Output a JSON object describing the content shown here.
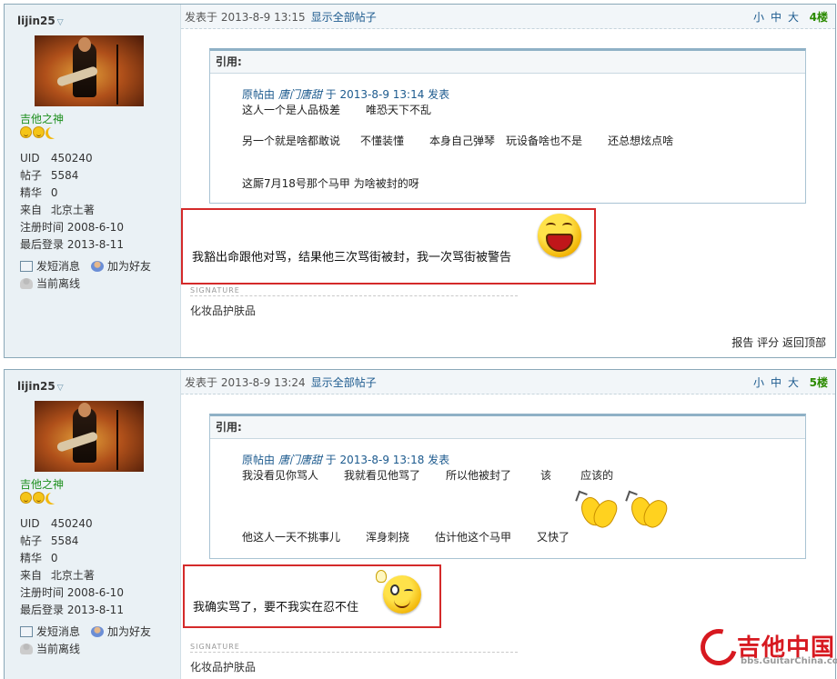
{
  "posts": [
    {
      "user": {
        "name": "lijin25",
        "rank": "吉他之神",
        "stats": [
          {
            "label": "UID",
            "value": "450240"
          },
          {
            "label": "帖子",
            "value": "5584"
          },
          {
            "label": "精华",
            "value": "0"
          },
          {
            "label": "来自",
            "value": "北京土著"
          },
          {
            "label": "注册时间",
            "value": "2008-6-10"
          },
          {
            "label": "最后登录",
            "value": "2013-8-11"
          }
        ],
        "send_msg": "发短消息",
        "add_friend": "加为好友",
        "status": "当前离线"
      },
      "posted_at": "发表于 2013-8-9 13:15",
      "show_all": "显示全部帖子",
      "font_small": "小",
      "font_medium": "中",
      "font_large": "大",
      "floor": "4楼",
      "quote": {
        "label": "引用:",
        "lines": [
          {
            "prefix": "原帖由",
            "author": "唐门唐甜",
            "suffix": "于 2013-8-9 13:14 发表"
          },
          {
            "parts": [
              "这人一个是人品极差",
              "唯恐天下不乱"
            ]
          },
          {
            "parts": [
              "另一个就是啥都敢说",
              "不懂装懂",
              "本身自己弹琴",
              "玩设备啥也不是",
              "还总想炫点啥"
            ]
          },
          {
            "parts": [
              "这厮7月18号那个马甲 为啥被封的呀"
            ]
          }
        ]
      },
      "message": "我豁出命跟他对骂，结果他三次骂街被封，我一次骂街被警告",
      "signature_label": "SIGNATURE",
      "signature": "化妆品护肤品",
      "footer": {
        "report": "报告",
        "rate": "评分",
        "top": "返回顶部"
      }
    },
    {
      "user": {
        "name": "lijin25",
        "rank": "吉他之神",
        "stats": [
          {
            "label": "UID",
            "value": "450240"
          },
          {
            "label": "帖子",
            "value": "5584"
          },
          {
            "label": "精华",
            "value": "0"
          },
          {
            "label": "来自",
            "value": "北京土著"
          },
          {
            "label": "注册时间",
            "value": "2008-6-10"
          },
          {
            "label": "最后登录",
            "value": "2013-8-11"
          }
        ],
        "send_msg": "发短消息",
        "add_friend": "加为好友",
        "status": "当前离线"
      },
      "posted_at": "发表于 2013-8-9 13:24",
      "show_all": "显示全部帖子",
      "font_small": "小",
      "font_medium": "中",
      "font_large": "大",
      "floor": "5楼",
      "quote": {
        "label": "引用:",
        "lines": [
          {
            "prefix": "原帖由",
            "author": "唐门唐甜",
            "suffix": "于 2013-8-9 13:18 发表"
          },
          {
            "parts": [
              "我没看见你骂人",
              "我就看见他骂了",
              "所以他被封了",
              "该",
              "应该的"
            ]
          },
          {
            "parts": [
              "他这人一天不挑事儿",
              "浑身刺挠",
              "估计他这个马甲",
              "又快了"
            ]
          }
        ]
      },
      "message": "我确实骂了，要不我实在忍不住",
      "signature_label": "SIGNATURE",
      "signature": "化妆品护肤品"
    }
  ],
  "watermark": {
    "title": "吉他中国",
    "url": "bbs.GuitarChina.com"
  },
  "colors": {
    "highlight_border": "#d42a2a",
    "link": "#1c5a8e",
    "rank": "#1d8f1d",
    "floor": "#2a8a00",
    "sidebar_bg": "#eaf1f5"
  }
}
